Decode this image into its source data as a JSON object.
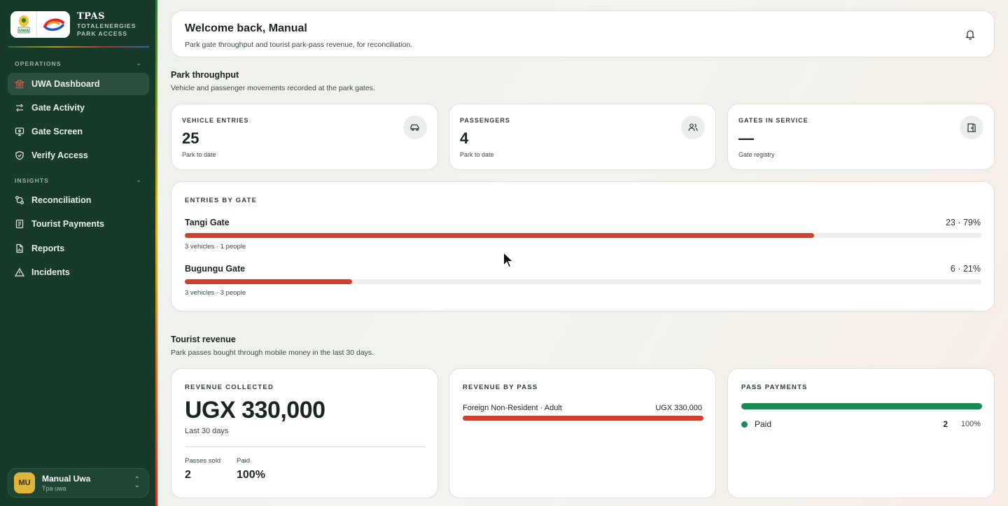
{
  "sidebar": {
    "brand": {
      "uwa_logo_text": "UWA",
      "title": "TPAS",
      "subtitle_line1": "TOTALENERGIES",
      "subtitle_line2": "PARK ACCESS"
    },
    "sections": [
      {
        "label": "OPERATIONS",
        "items": [
          {
            "label": "UWA Dashboard",
            "icon": "bank-icon",
            "active": true
          },
          {
            "label": "Gate Activity",
            "icon": "activity-icon"
          },
          {
            "label": "Gate Screen",
            "icon": "monitor-icon"
          },
          {
            "label": "Verify Access",
            "icon": "shield-check-icon"
          }
        ]
      },
      {
        "label": "INSIGHTS",
        "items": [
          {
            "label": "Reconciliation",
            "icon": "reconcile-icon"
          },
          {
            "label": "Tourist Payments",
            "icon": "receipt-icon"
          },
          {
            "label": "Reports",
            "icon": "document-icon"
          },
          {
            "label": "Incidents",
            "icon": "warning-icon"
          }
        ]
      }
    ],
    "user": {
      "initials": "MU",
      "name": "Manual Uwa",
      "sub": "Tpa uwa"
    }
  },
  "header": {
    "title": "Welcome back, Manual",
    "subtitle": "Park gate throughput and tourist park-pass revenue, for reconciliation."
  },
  "throughput": {
    "title": "Park throughput",
    "subtitle": "Vehicle and passenger movements recorded at the park gates.",
    "stats": [
      {
        "label": "VEHICLE ENTRIES",
        "value": "25",
        "caption": "Park to date",
        "icon": "car-icon"
      },
      {
        "label": "PASSENGERS",
        "value": "4",
        "caption": "Park to date",
        "icon": "users-icon"
      },
      {
        "label": "GATES IN SERVICE",
        "value": "—",
        "caption": "Gate registry",
        "icon": "gate-icon"
      }
    ],
    "entries_by_gate": {
      "label": "ENTRIES BY GATE",
      "gates": [
        {
          "name": "Tangi Gate",
          "stat": "23 · 79%",
          "detail": "3 vehicles · 1 people",
          "share": 0.79
        },
        {
          "name": "Bugungu Gate",
          "stat": "6 · 21%",
          "detail": "3 vehicles · 3 people",
          "share": 0.21
        }
      ]
    }
  },
  "revenue": {
    "title": "Tourist revenue",
    "subtitle": "Park passes bought through mobile money in the last 30 days.",
    "collected": {
      "label": "REVENUE COLLECTED",
      "amount": "UGX 330,000",
      "period": "Last 30 days",
      "passes_sold_label": "Passes sold",
      "passes_sold": "2",
      "paid_label": "Paid",
      "paid": "100%"
    },
    "by_pass": {
      "label": "REVENUE BY PASS",
      "rows": [
        {
          "name": "Foreign Non-Resident · Adult",
          "amount": "UGX 330,000",
          "share": 1.0
        }
      ]
    },
    "payments": {
      "label": "PASS PAYMENTS",
      "paid_share": 1.0,
      "rows": [
        {
          "status": "Paid",
          "count": "2",
          "percent": "100%",
          "color": "#1a8a52"
        }
      ]
    }
  },
  "colors": {
    "sidebar_bg": "#173a2a",
    "accent_red": "#d0402c",
    "paid_green": "#1a8a52",
    "avatar_gold": "#e0b63a"
  }
}
